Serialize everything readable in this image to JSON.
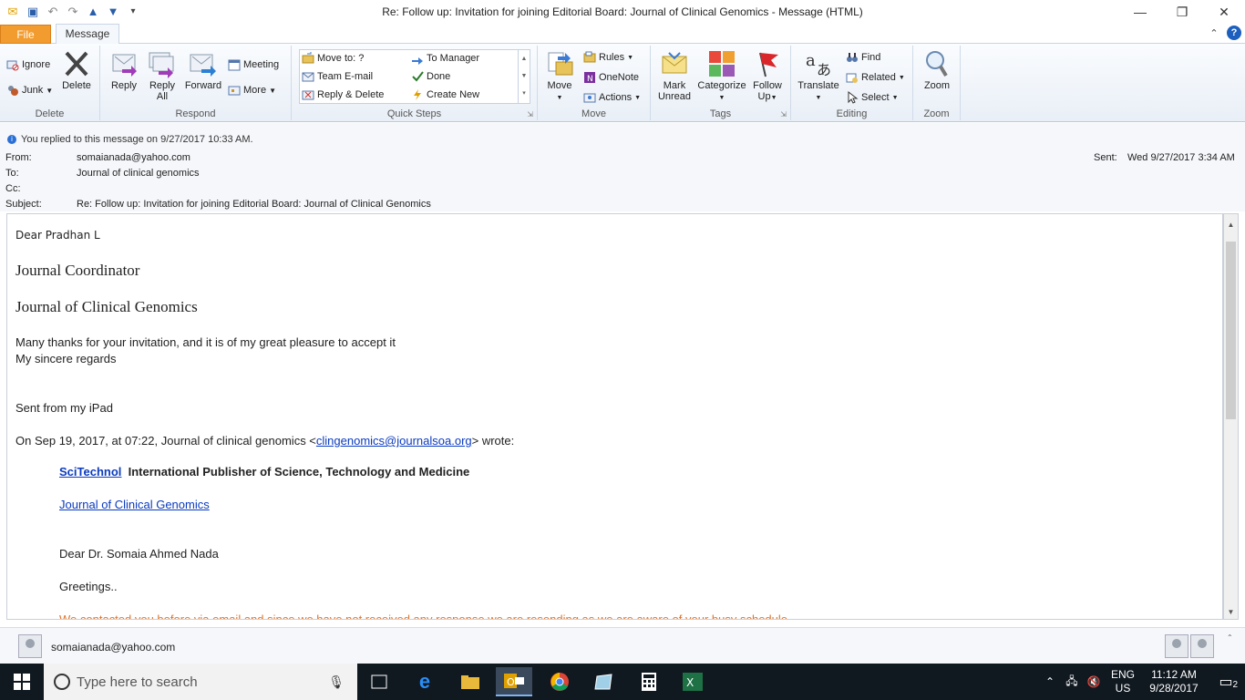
{
  "window": {
    "title": "Re: Follow up: Invitation for joining Editorial Board: Journal of Clinical Genomics  -  Message (HTML)"
  },
  "tabs": {
    "file": "File",
    "message": "Message"
  },
  "ribbon": {
    "delete_group": {
      "label": "Delete",
      "ignore": "Ignore",
      "junk": "Junk",
      "delete": "Delete"
    },
    "respond_group": {
      "label": "Respond",
      "reply": "Reply",
      "reply_all_1": "Reply",
      "reply_all_2": "All",
      "forward": "Forward",
      "meeting": "Meeting",
      "more": "More"
    },
    "quicksteps_group": {
      "label": "Quick Steps",
      "move_to": "Move to: ?",
      "team_email": "Team E-mail",
      "reply_delete": "Reply & Delete",
      "to_manager": "To Manager",
      "done": "Done",
      "create_new": "Create New"
    },
    "move_group": {
      "label": "Move",
      "move": "Move",
      "rules": "Rules",
      "onenote": "OneNote",
      "actions": "Actions"
    },
    "tags_group": {
      "label": "Tags",
      "mark_unread_1": "Mark",
      "mark_unread_2": "Unread",
      "categorize": "Categorize",
      "follow_up_1": "Follow",
      "follow_up_2": "Up"
    },
    "editing_group": {
      "label": "Editing",
      "translate": "Translate",
      "find": "Find",
      "related": "Related",
      "select": "Select"
    },
    "zoom_group": {
      "label": "Zoom",
      "zoom": "Zoom"
    }
  },
  "info": {
    "replied": "You replied to this message on 9/27/2017 10:33 AM."
  },
  "header": {
    "from_label": "From:",
    "from": "somaianada@yahoo.com",
    "to_label": "To:",
    "to": "Journal of clinical genomics",
    "cc_label": "Cc:",
    "subject_label": "Subject:",
    "subject": "Re: Follow up: Invitation for joining Editorial Board: Journal of Clinical Genomics",
    "sent_label": "Sent:",
    "sent": "Wed 9/27/2017 3:34 AM"
  },
  "body": {
    "greeting": "Dear Pradhan L",
    "line_title": "Journal Coordinator",
    "line_journal": "Journal of Clinical Genomics",
    "thanks": "Many thanks for your invitation, and it is of my great pleasure to accept it",
    "regards": "My sincere regards",
    "ipad": "Sent from my iPad",
    "quote_pre": "On Sep 19, 2017, at 07:22, Journal of clinical genomics <",
    "quote_email": "clingenomics@journalsoa.org",
    "quote_post": "> wrote:",
    "scitechnol": "SciTechnol",
    "publisher": "International Publisher of Science, Technology and Medicine",
    "journal_link": "Journal of Clinical Genomics",
    "dear_dr": "Dear Dr. Somaia Ahmed Nada",
    "greetings": "Greetings..",
    "contacted": "We contacted you before via email and since we have not received any response we are resending as we are aware of your busy schedule"
  },
  "people": {
    "name": "somaianada@yahoo.com"
  },
  "taskbar": {
    "search_placeholder": "Type here to search",
    "lang_1": "ENG",
    "lang_2": "US",
    "time": "11:12 AM",
    "date": "9/28/2017",
    "notifications": "2"
  }
}
